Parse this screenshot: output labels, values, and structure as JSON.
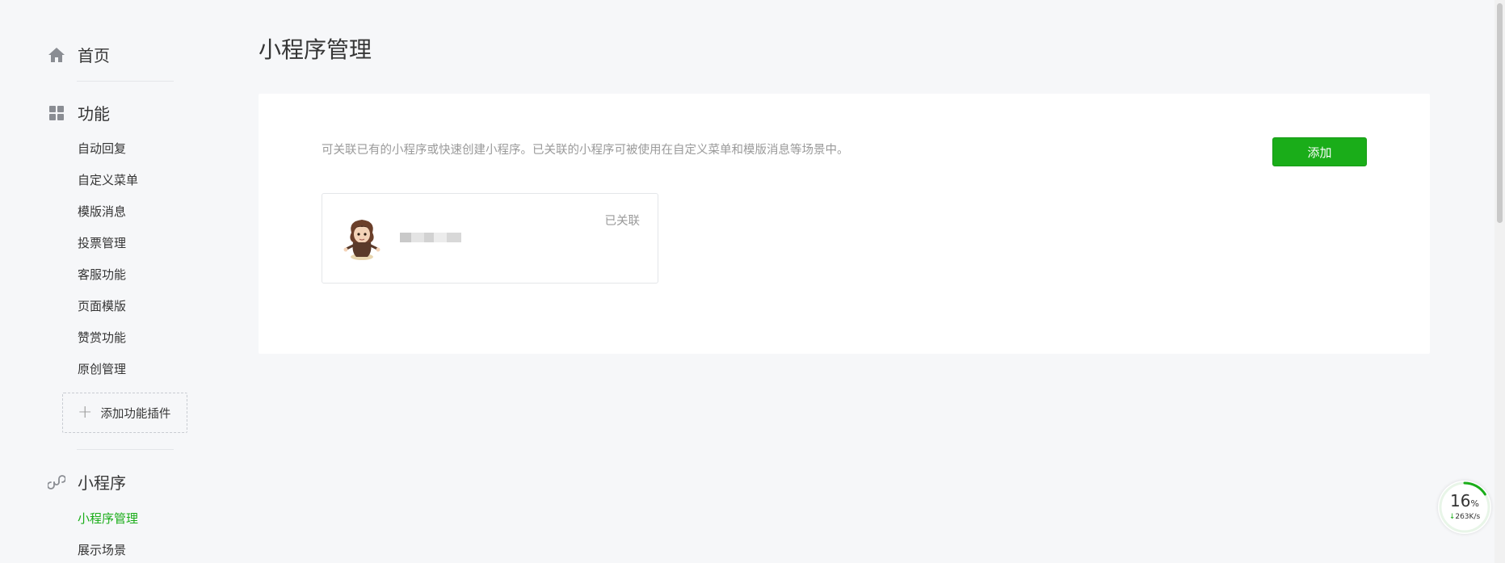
{
  "sidebar": {
    "home": {
      "label": "首页",
      "icon": "home-icon"
    },
    "features": {
      "label": "功能",
      "icon": "grid-icon",
      "items": [
        {
          "label": "自动回复"
        },
        {
          "label": "自定义菜单"
        },
        {
          "label": "模版消息"
        },
        {
          "label": "投票管理"
        },
        {
          "label": "客服功能"
        },
        {
          "label": "页面模版"
        },
        {
          "label": "赞赏功能"
        },
        {
          "label": "原创管理"
        }
      ],
      "add_plugin_label": "添加功能插件"
    },
    "miniprogram": {
      "label": "小程序",
      "icon": "link-icon",
      "items": [
        {
          "label": "小程序管理",
          "active": true
        },
        {
          "label": "展示场景",
          "active": false
        }
      ]
    }
  },
  "main": {
    "title": "小程序管理",
    "description": "可关联已有的小程序或快速创建小程序。已关联的小程序可被使用在自定义菜单和模版消息等场景中。",
    "add_button_label": "添加",
    "cards": [
      {
        "status": "已关联",
        "name": ""
      }
    ]
  },
  "speed_widget": {
    "percent": "16",
    "percent_sign": "%",
    "rate": "263K/s",
    "progress": 0.16
  },
  "colors": {
    "accent": "#1aad19",
    "text": "#353535",
    "muted": "#9a9a9a",
    "background": "#f6f7f9"
  }
}
